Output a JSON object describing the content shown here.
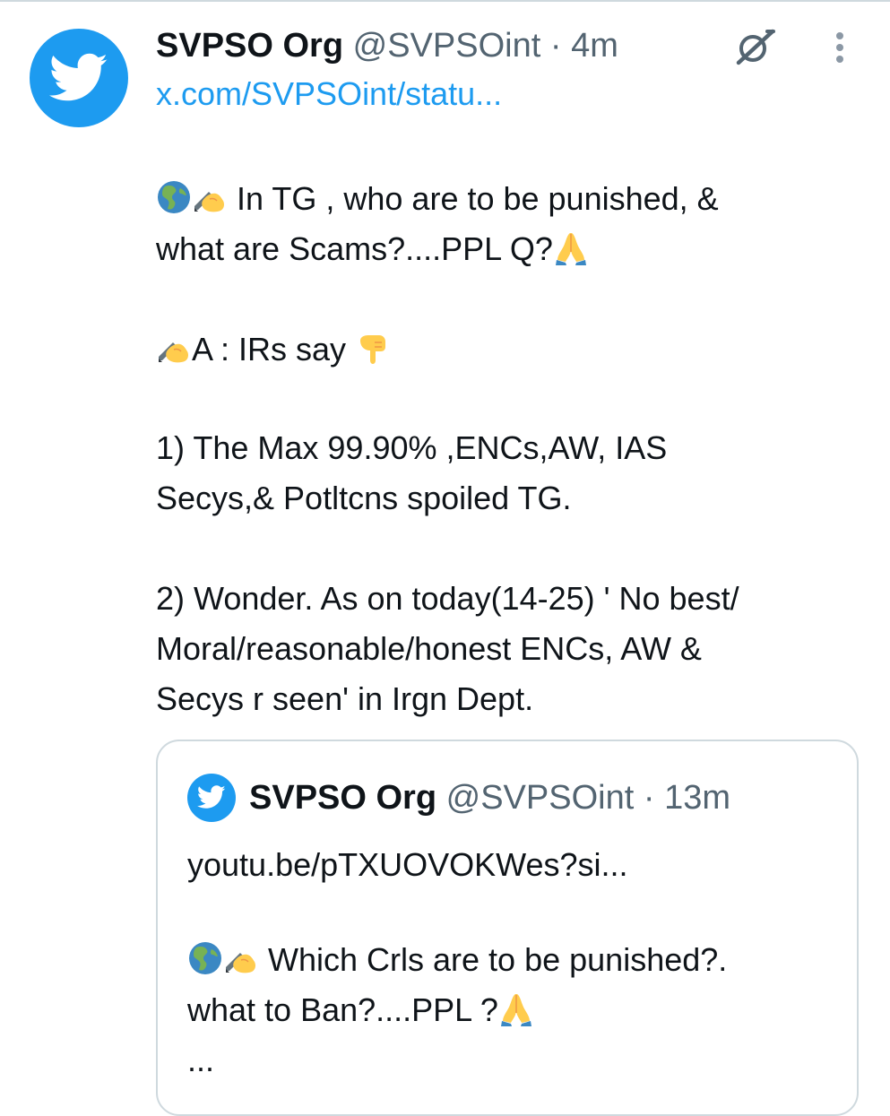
{
  "tweet": {
    "author_name": "SVPSO Org",
    "author_handle": "@SVPSOint",
    "separator": "·",
    "time": "4m",
    "link": "x.com/SVPSOint/statu...",
    "lines": {
      "l1": "In TG , who are to be punished, &",
      "l2": "what are Scams?....PPL Q?",
      "l3": "A : IRs say",
      "l4": "1) The Max 99.90% ,ENCs,AW, IAS",
      "l5": "Secys,& Potltcns spoiled TG.",
      "l6": "2) Wonder. As on today(14-25) ' No best/",
      "l7": "Moral/reasonable/honest ENCs, AW &",
      "l8": "Secys r seen' in Irgn Dept."
    }
  },
  "quoted_tweet": {
    "author_name": "SVPSO Org",
    "author_handle": "@SVPSOint",
    "separator": "·",
    "time": "13m",
    "link": "youtu.be/pTXUOVOKWes?si...",
    "lines": {
      "l1": "Which Crls are to be punished?.",
      "l2": "what to Ban?....PPL ?",
      "l3": "..."
    }
  },
  "icons": {
    "avatar": "twitter-bird-icon",
    "grok": "grok-icon",
    "more": "more-vertical-icon",
    "emojis": [
      "globe-americas-icon",
      "writing-hand-icon",
      "folded-hands-icon",
      "pointing-down-icon"
    ]
  },
  "colors": {
    "brand_blue": "#1d9bf0",
    "text": "#0f1419",
    "secondary": "#536471",
    "border": "#cfd9de"
  }
}
